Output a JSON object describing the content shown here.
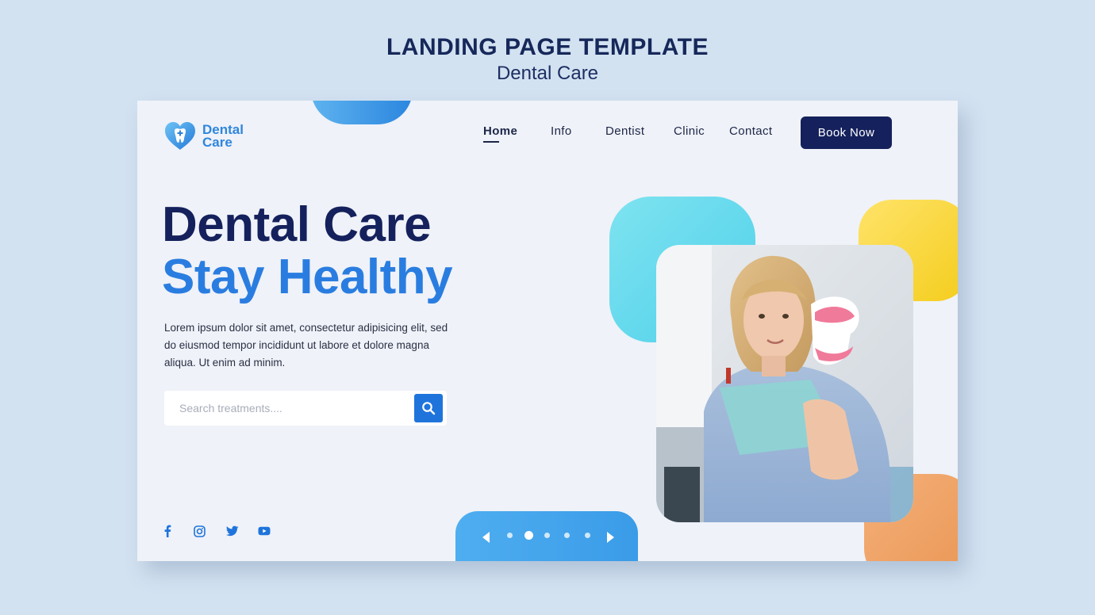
{
  "heading": {
    "title": "LANDING PAGE TEMPLATE",
    "subtitle": "Dental Care"
  },
  "brand": {
    "line1": "Dental",
    "line2": "Care",
    "icon": "heart-tooth-icon"
  },
  "nav": {
    "items": [
      {
        "label": "Home",
        "active": true
      },
      {
        "label": "Info",
        "active": false
      },
      {
        "label": "Dentist",
        "active": false
      },
      {
        "label": "Clinic",
        "active": false
      },
      {
        "label": "Contact",
        "active": false
      }
    ],
    "cta": "Book Now"
  },
  "hero": {
    "title": "Dental Care",
    "subtitle": "Stay Healthy",
    "description": "Lorem ipsum dolor sit amet, consectetur adipisicing elit, sed do eiusmod tempor incididunt ut labore et dolore magna aliqua. Ut enim ad minim."
  },
  "search": {
    "placeholder": "Search treatments....",
    "icon": "search-icon"
  },
  "social": [
    "facebook-icon",
    "instagram-icon",
    "twitter-icon",
    "youtube-icon"
  ],
  "slider": {
    "dots": 5,
    "active_index": 1
  },
  "colors": {
    "navy": "#15215c",
    "blue": "#2a7de0",
    "cyan": "#4fd0ea",
    "yellow": "#f4cd1c",
    "orange": "#e99654",
    "page_bg": "#d3e2f1"
  }
}
